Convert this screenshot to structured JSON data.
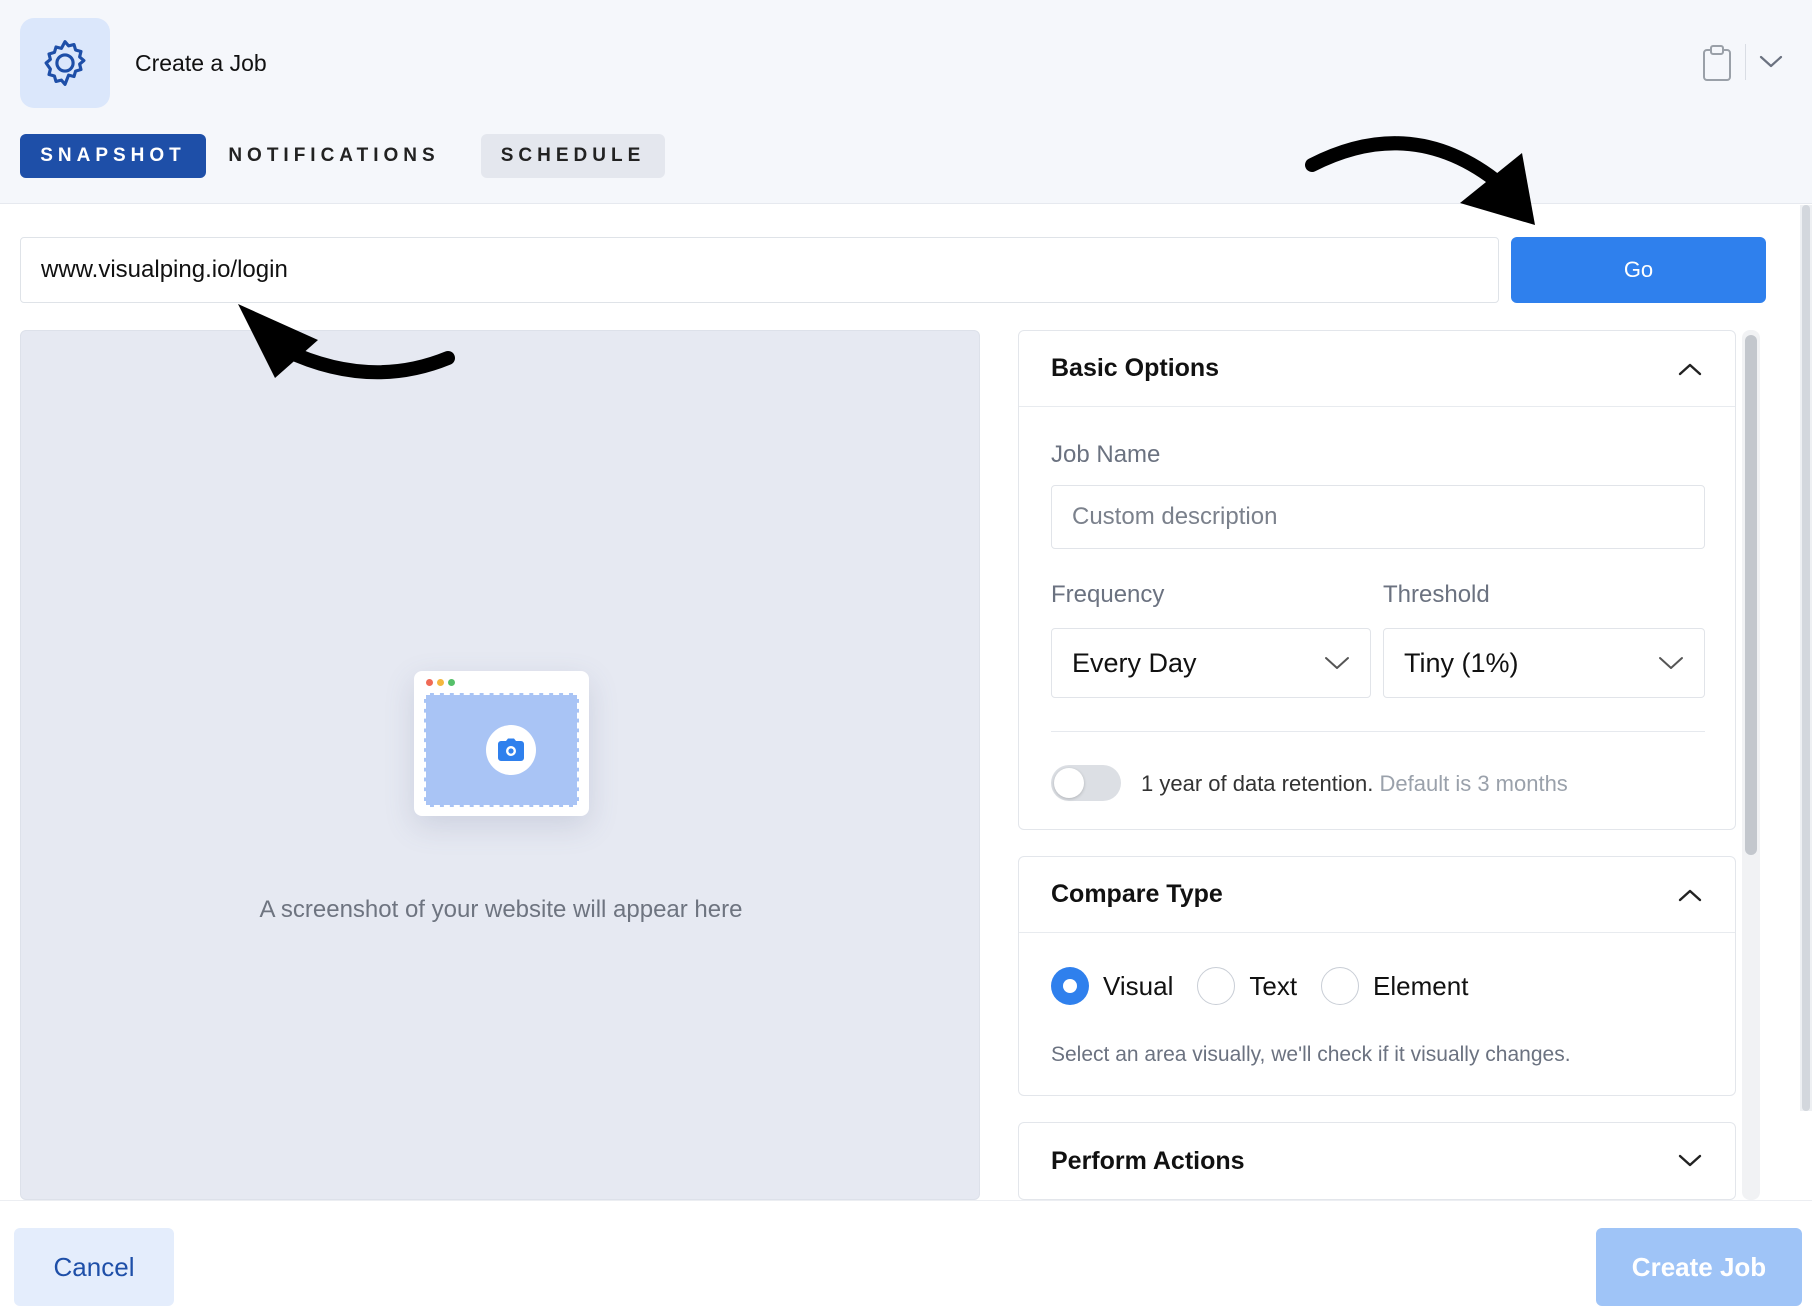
{
  "header": {
    "title": "Create a Job",
    "icons": {
      "settings": "gear-icon",
      "clipboard": "clipboard-icon",
      "menu": "chevron-down-icon"
    }
  },
  "tabs": [
    {
      "label": "SNAPSHOT",
      "active": true
    },
    {
      "label": "NOTIFICATIONS",
      "active": false
    },
    {
      "label": "SCHEDULE",
      "active": false
    }
  ],
  "url_bar": {
    "value": "www.visualping.io/login",
    "go_label": "Go"
  },
  "preview": {
    "caption": "A screenshot of your website will appear here",
    "icon": "camera-icon"
  },
  "basic_options": {
    "title": "Basic Options",
    "expanded": true,
    "job_name_label": "Job Name",
    "job_name_placeholder": "Custom description",
    "job_name_value": "",
    "frequency_label": "Frequency",
    "frequency_value": "Every Day",
    "threshold_label": "Threshold",
    "threshold_value": "Tiny (1%)",
    "retention_enabled": false,
    "retention_text": "1 year of data retention.",
    "retention_note": "Default is 3 months"
  },
  "compare_type": {
    "title": "Compare Type",
    "expanded": true,
    "options": [
      {
        "label": "Visual",
        "selected": true
      },
      {
        "label": "Text",
        "selected": false
      },
      {
        "label": "Element",
        "selected": false
      }
    ],
    "description": "Select an area visually, we'll check if it visually changes."
  },
  "perform_actions": {
    "title": "Perform Actions",
    "expanded": false
  },
  "footer": {
    "cancel_label": "Cancel",
    "create_label": "Create Job"
  },
  "colors": {
    "primary": "#2f80ed",
    "tab_active": "#1e4fa8",
    "create_disabled": "#9fc4f7",
    "header_bg": "#f5f7fb",
    "preview_bg": "#e6e9f2"
  }
}
